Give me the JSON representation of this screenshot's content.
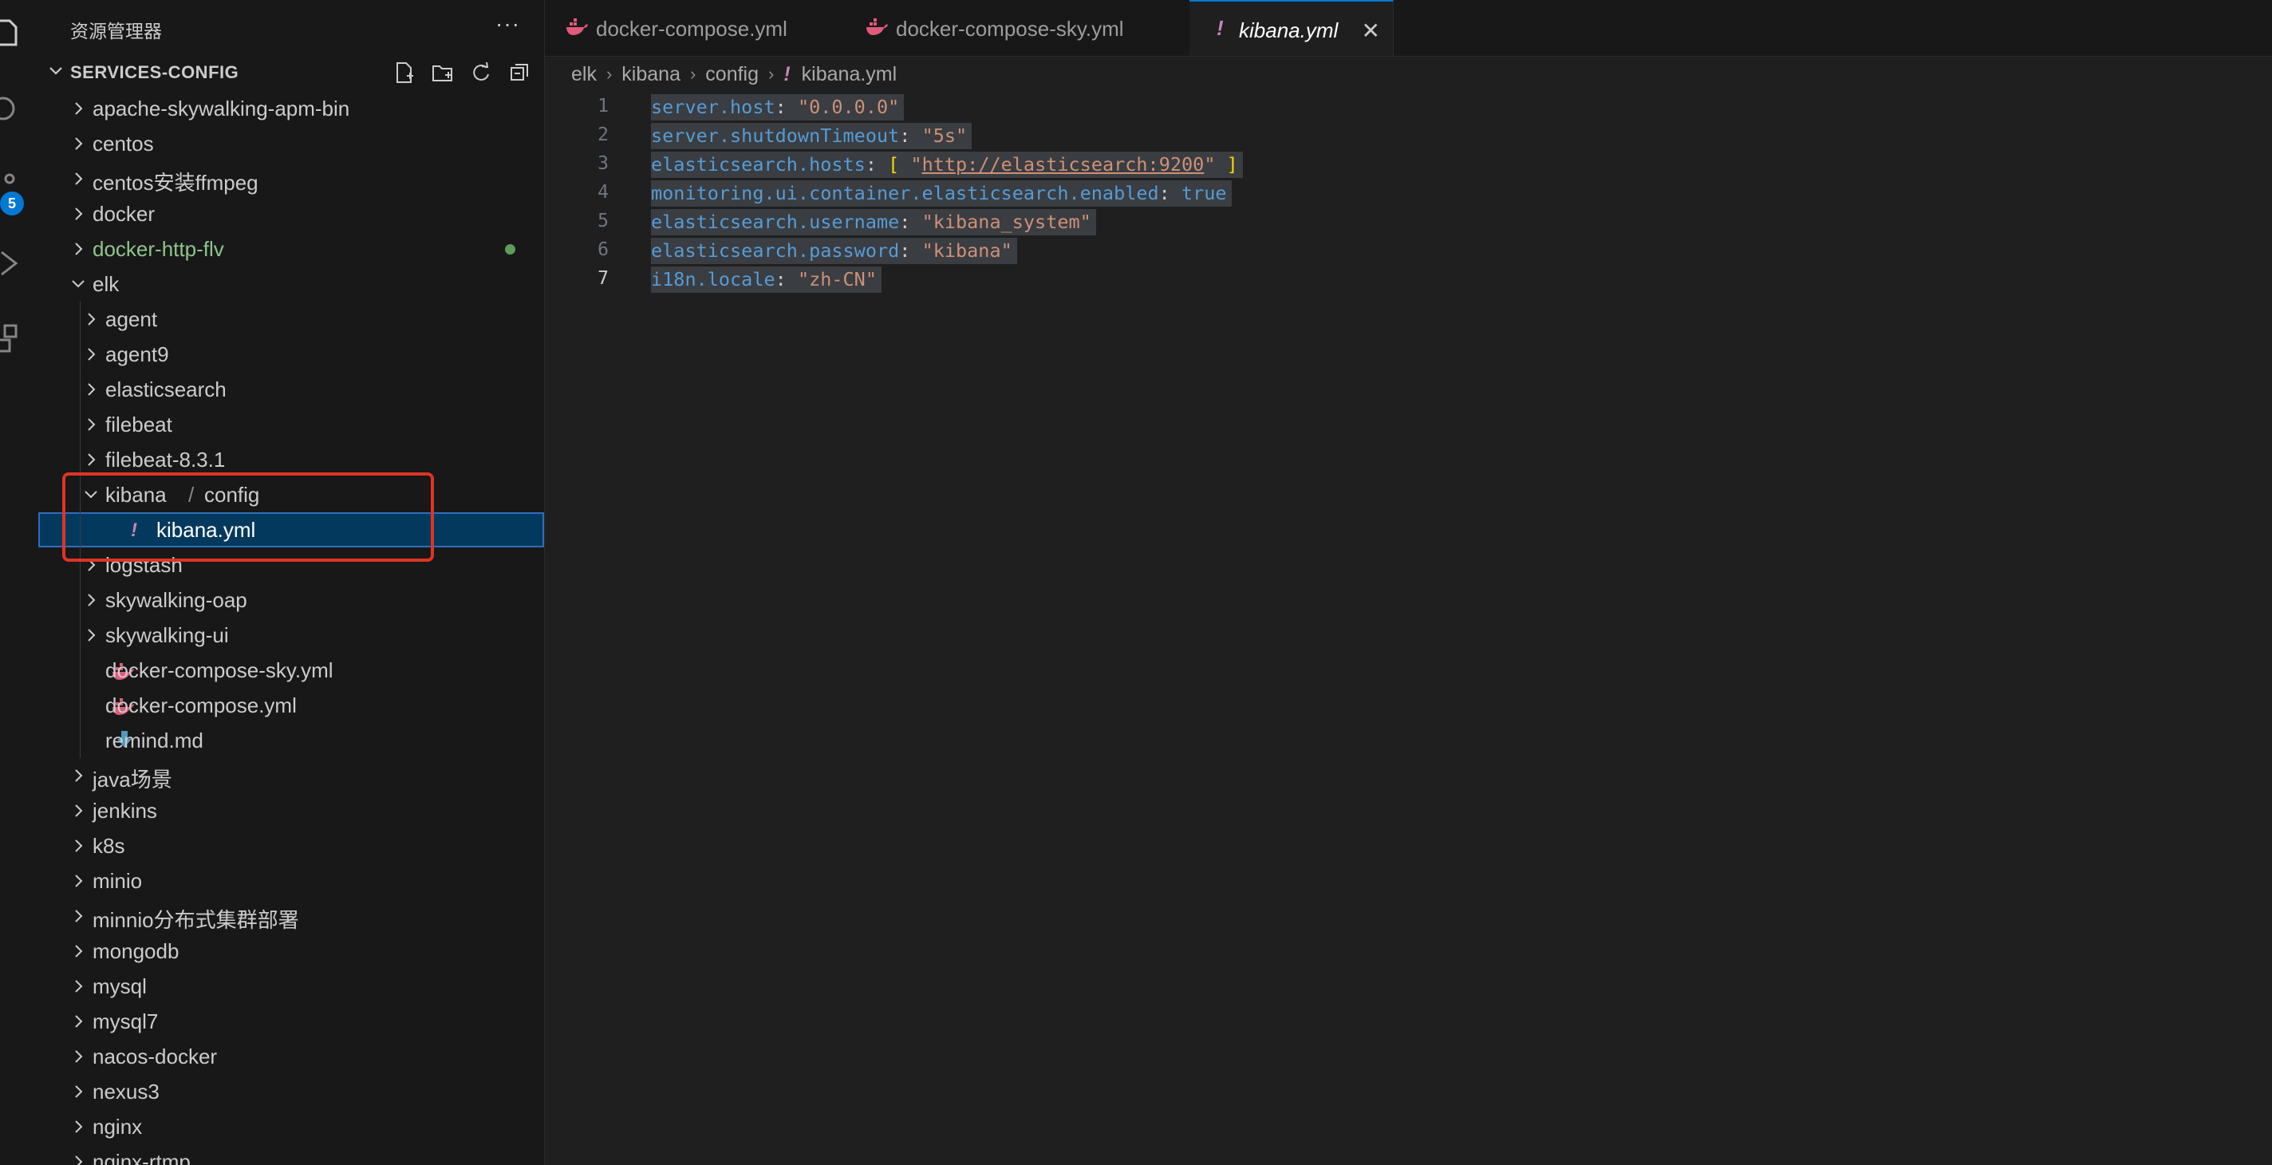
{
  "sidebar": {
    "title": "资源管理器",
    "more_glyph": "···",
    "section_title": "SERVICES-CONFIG",
    "section_actions": [
      "new-file-icon",
      "new-folder-icon",
      "refresh-icon",
      "collapse-all-icon"
    ],
    "scm_badge": "5",
    "tree": [
      {
        "label": "apache-skywalking-apm-bin",
        "depth": 0,
        "type": "folder",
        "open": false
      },
      {
        "label": "centos",
        "depth": 0,
        "type": "folder",
        "open": false
      },
      {
        "label": "centos安装ffmpeg",
        "depth": 0,
        "type": "folder",
        "open": false
      },
      {
        "label": "docker",
        "depth": 0,
        "type": "folder",
        "open": false
      },
      {
        "label": "docker-http-flv",
        "depth": 0,
        "type": "folder",
        "open": false,
        "modified": true
      },
      {
        "label": "elk",
        "depth": 0,
        "type": "folder",
        "open": true
      },
      {
        "label": "agent",
        "depth": 1,
        "type": "folder",
        "open": false
      },
      {
        "label": "agent9",
        "depth": 1,
        "type": "folder",
        "open": false
      },
      {
        "label": "elasticsearch",
        "depth": 1,
        "type": "folder",
        "open": false
      },
      {
        "label": "filebeat",
        "depth": 1,
        "type": "folder",
        "open": false
      },
      {
        "label": "filebeat-8.3.1",
        "depth": 1,
        "type": "folder",
        "open": false
      },
      {
        "label": "kibana",
        "label2": "config",
        "sep": "/",
        "depth": 1,
        "type": "folder",
        "open": true
      },
      {
        "label": "kibana.yml",
        "depth": 2,
        "type": "yaml",
        "selected": true
      },
      {
        "label": "logstash",
        "depth": 1,
        "type": "folder",
        "open": false
      },
      {
        "label": "skywalking-oap",
        "depth": 1,
        "type": "folder",
        "open": false
      },
      {
        "label": "skywalking-ui",
        "depth": 1,
        "type": "folder",
        "open": false
      },
      {
        "label": "docker-compose-sky.yml",
        "depth": 1,
        "type": "docker"
      },
      {
        "label": "docker-compose.yml",
        "depth": 1,
        "type": "docker"
      },
      {
        "label": "remind.md",
        "depth": 1,
        "type": "markdown"
      },
      {
        "label": "java场景",
        "depth": 0,
        "type": "folder",
        "open": false
      },
      {
        "label": "jenkins",
        "depth": 0,
        "type": "folder",
        "open": false
      },
      {
        "label": "k8s",
        "depth": 0,
        "type": "folder",
        "open": false
      },
      {
        "label": "minio",
        "depth": 0,
        "type": "folder",
        "open": false
      },
      {
        "label": "minnio分布式集群部署",
        "depth": 0,
        "type": "folder",
        "open": false
      },
      {
        "label": "mongodb",
        "depth": 0,
        "type": "folder",
        "open": false
      },
      {
        "label": "mysql",
        "depth": 0,
        "type": "folder",
        "open": false
      },
      {
        "label": "mysql7",
        "depth": 0,
        "type": "folder",
        "open": false
      },
      {
        "label": "nacos-docker",
        "depth": 0,
        "type": "folder",
        "open": false
      },
      {
        "label": "nexus3",
        "depth": 0,
        "type": "folder",
        "open": false
      },
      {
        "label": "nginx",
        "depth": 0,
        "type": "folder",
        "open": false
      },
      {
        "label": "nginx-rtmp",
        "depth": 0,
        "type": "folder",
        "open": false
      }
    ]
  },
  "tabs": [
    {
      "label": "docker-compose.yml",
      "icon": "docker-icon",
      "active": false
    },
    {
      "label": "docker-compose-sky.yml",
      "icon": "docker-icon",
      "active": false
    },
    {
      "label": "kibana.yml",
      "icon": "yaml-icon",
      "active": true,
      "close": "✕"
    }
  ],
  "breadcrumb": [
    "elk",
    "kibana",
    "config",
    "kibana.yml"
  ],
  "editor": {
    "current_line": 7,
    "lines": [
      [
        [
          "k",
          "server.host"
        ],
        [
          "p",
          ": "
        ],
        [
          "s",
          "\"0.0.0.0\""
        ]
      ],
      [
        [
          "k",
          "server.shutdownTimeout"
        ],
        [
          "p",
          ": "
        ],
        [
          "s",
          "\"5s\""
        ]
      ],
      [
        [
          "k",
          "elasticsearch.hosts"
        ],
        [
          "p",
          ": "
        ],
        [
          "b",
          "["
        ],
        [
          "p",
          " "
        ],
        [
          "s",
          "\""
        ],
        [
          "su",
          "http://elasticsearch:9200"
        ],
        [
          "s",
          "\""
        ],
        [
          "p",
          " "
        ],
        [
          "b",
          "]"
        ]
      ],
      [
        [
          "k",
          "monitoring.ui.container.elasticsearch.enabled"
        ],
        [
          "p",
          ": "
        ],
        [
          "bool",
          "true"
        ]
      ],
      [
        [
          "k",
          "elasticsearch.username"
        ],
        [
          "p",
          ": "
        ],
        [
          "s",
          "\"kibana_system\""
        ]
      ],
      [
        [
          "k",
          "elasticsearch.password"
        ],
        [
          "p",
          ": "
        ],
        [
          "s",
          "\"kibana\""
        ]
      ],
      [
        [
          "k",
          "i18n.locale"
        ],
        [
          "p",
          ": "
        ],
        [
          "s",
          "\"zh-CN\""
        ]
      ]
    ]
  },
  "colors": {
    "accent": "#0078d4",
    "highlight_box": "#e03324",
    "yaml_icon": "#c586c0",
    "docker_icon": "#e05a7a",
    "markdown_icon": "#519aba"
  }
}
